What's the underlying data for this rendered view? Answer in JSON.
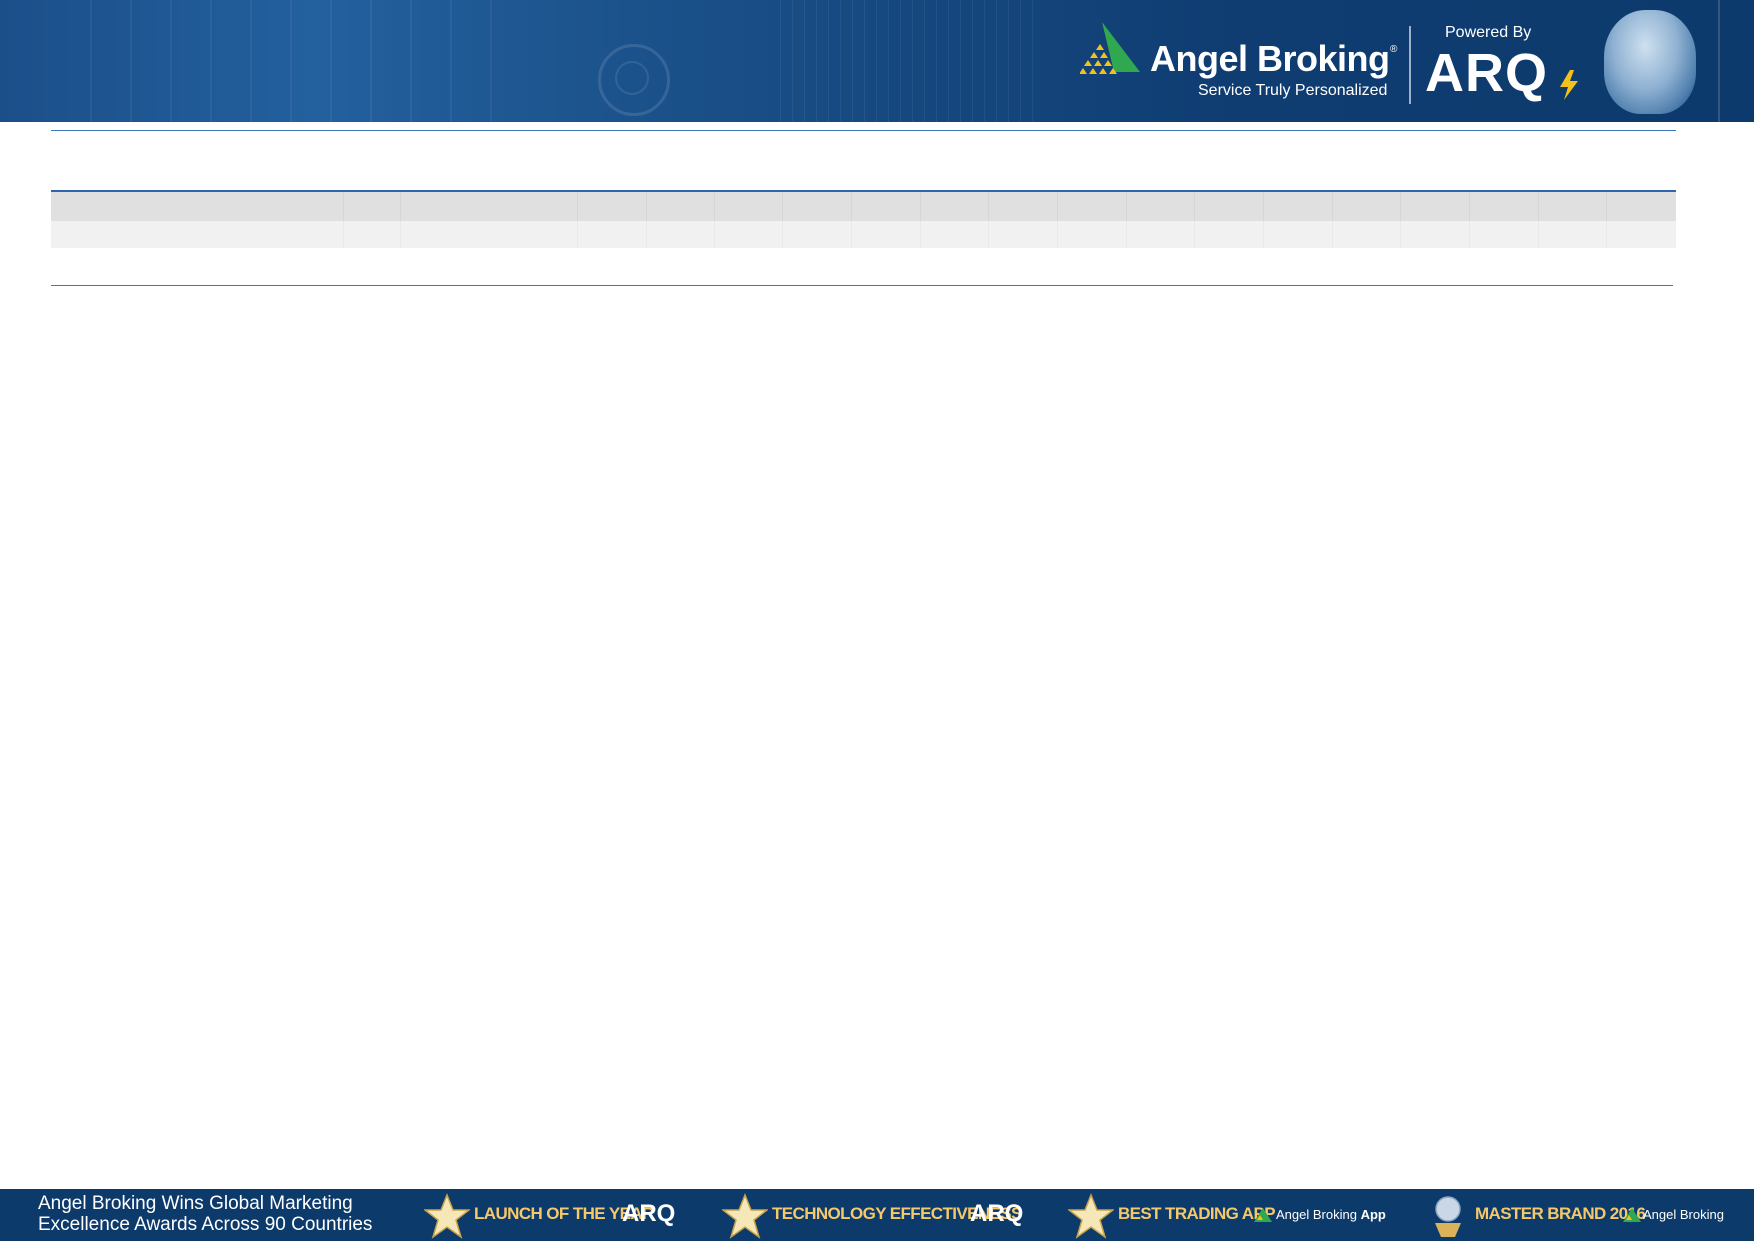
{
  "header": {
    "brand_name": "Angel Broking",
    "registered_mark": "®",
    "tagline": "Service Truly Personalized",
    "powered_by": "Powered By",
    "product_logo": "ARQ",
    "icons": [
      "angel-broking-logo-icon",
      "arq-bolt-icon",
      "robot-head-image"
    ]
  },
  "colors": {
    "header_blue": "#1a4f87",
    "footer_blue": "#0c3a6b",
    "rule_blue": "#3f75b8",
    "award_gold": "#f5c96a",
    "logo_green": "#2fa84f",
    "logo_yellow": "#f2c21b"
  },
  "table": {
    "header_row": [
      "",
      "",
      "",
      "",
      "",
      "",
      "",
      "",
      "",
      "",
      "",
      "",
      "",
      "",
      "",
      "",
      "",
      "",
      ""
    ],
    "rows": [
      [
        "",
        "",
        "",
        "",
        "",
        "",
        "",
        "",
        "",
        "",
        "",
        "",
        "",
        "",
        "",
        "",
        "",
        "",
        ""
      ]
    ]
  },
  "footer": {
    "title_line1": "Angel Broking Wins Global Marketing",
    "title_line2": "Excellence Awards Across 90 Countries",
    "awards": [
      {
        "label": "LAUNCH OF THE YEAR",
        "brand": "ARQ"
      },
      {
        "label": "TECHNOLOGY EFFECTIVENESS",
        "brand": "ARQ"
      },
      {
        "label": "BEST TRADING APP",
        "brand": "Angel Broking",
        "brand_suffix": "App"
      },
      {
        "label": "MASTER BRAND 2016",
        "brand": "Angel Broking"
      }
    ]
  }
}
